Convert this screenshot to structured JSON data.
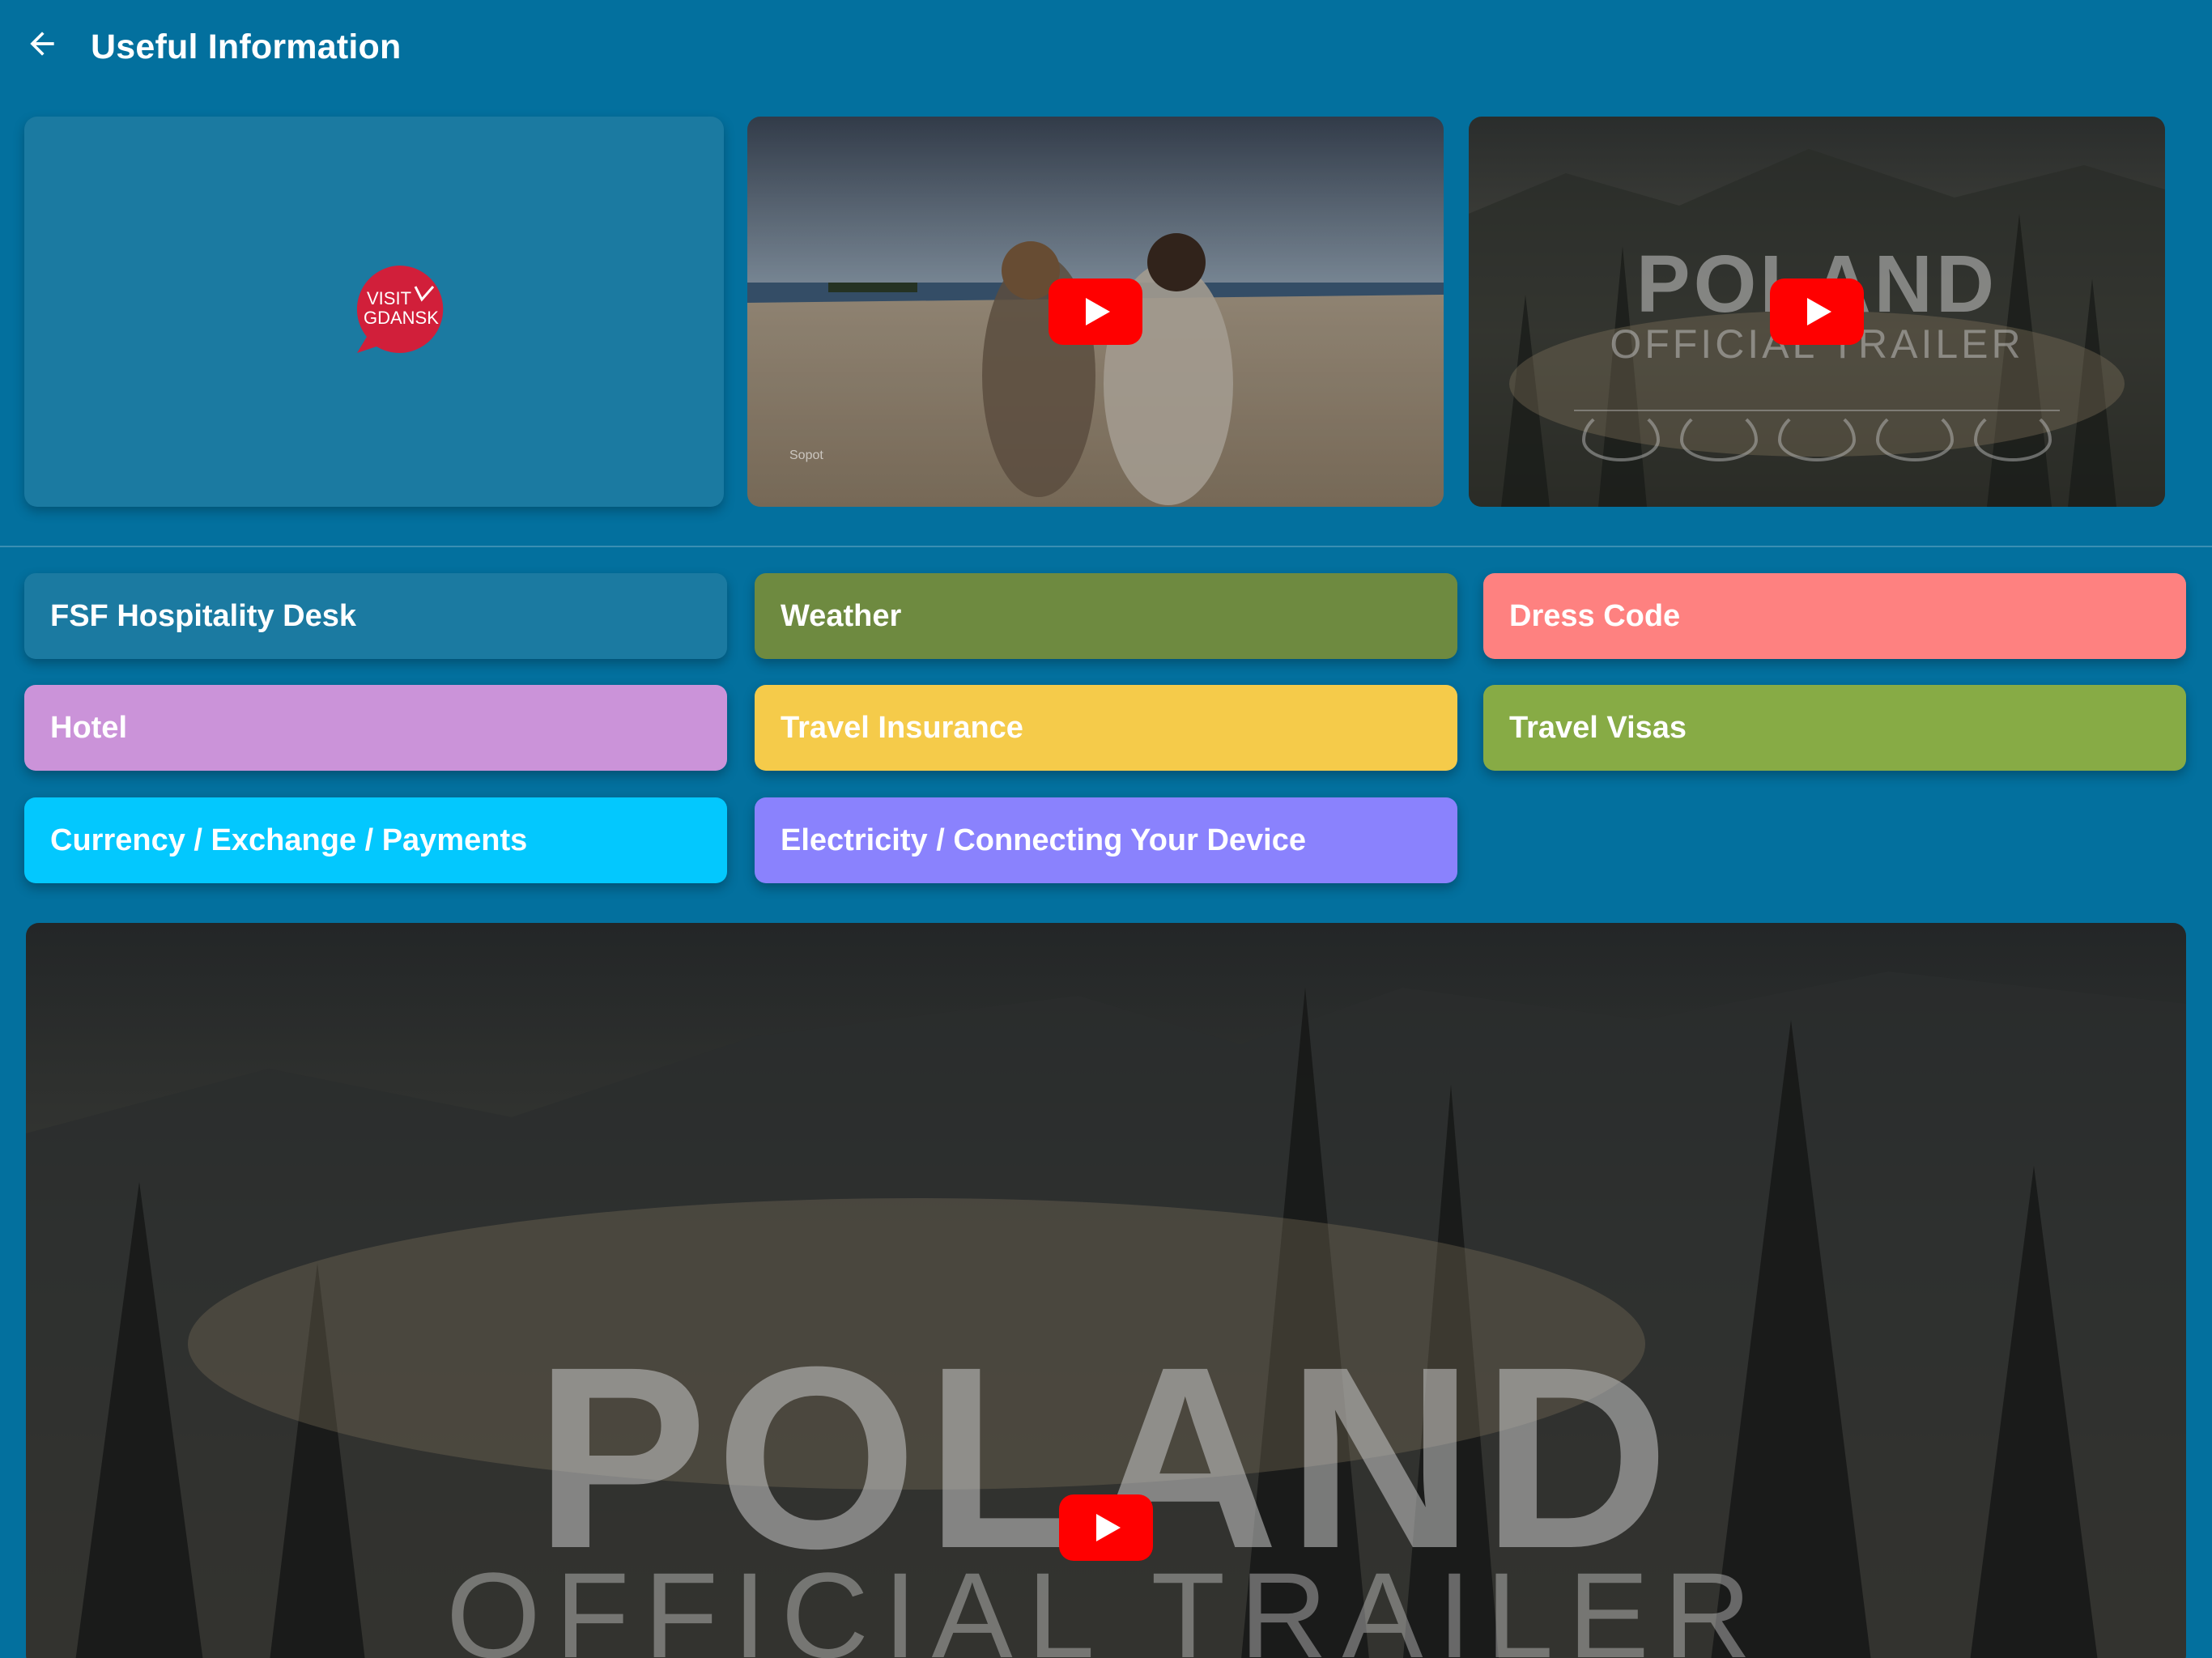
{
  "header": {
    "title": "Useful Information",
    "back_icon": "arrow-left-icon"
  },
  "videos": [
    {
      "kind": "logo",
      "logo_line1": "VISIT",
      "logo_line2": "GDANSK",
      "logo_color": "#d11f3a"
    },
    {
      "kind": "video",
      "caption": "Sopot",
      "play_icon": "youtube-play-icon"
    },
    {
      "kind": "video",
      "title": "POLAND",
      "subtitle": "OFFICIAL TRAILER",
      "play_icon": "youtube-play-icon"
    }
  ],
  "categories": [
    {
      "label": "FSF Hospitality Desk",
      "color": "#1b7aa1"
    },
    {
      "label": "Weather",
      "color": "#6e8a40"
    },
    {
      "label": "Dress Code",
      "color": "#fe8180"
    },
    {
      "label": "Hotel",
      "color": "#cb93d9"
    },
    {
      "label": "Travel Insurance",
      "color": "#f5cb4a"
    },
    {
      "label": "Travel Visas",
      "color": "#87ab45"
    },
    {
      "label": "Currency / Exchange / Payments",
      "color": "#03c8fe"
    },
    {
      "label": "Electricity / Connecting Your Device",
      "color": "#8a82fd"
    }
  ],
  "featured_video": {
    "title": "POLAND",
    "subtitle": "OFFICIAL TRAILER",
    "play_icon": "youtube-play-icon"
  },
  "colors": {
    "background": "#03709e",
    "youtube_red": "#ff0000"
  }
}
